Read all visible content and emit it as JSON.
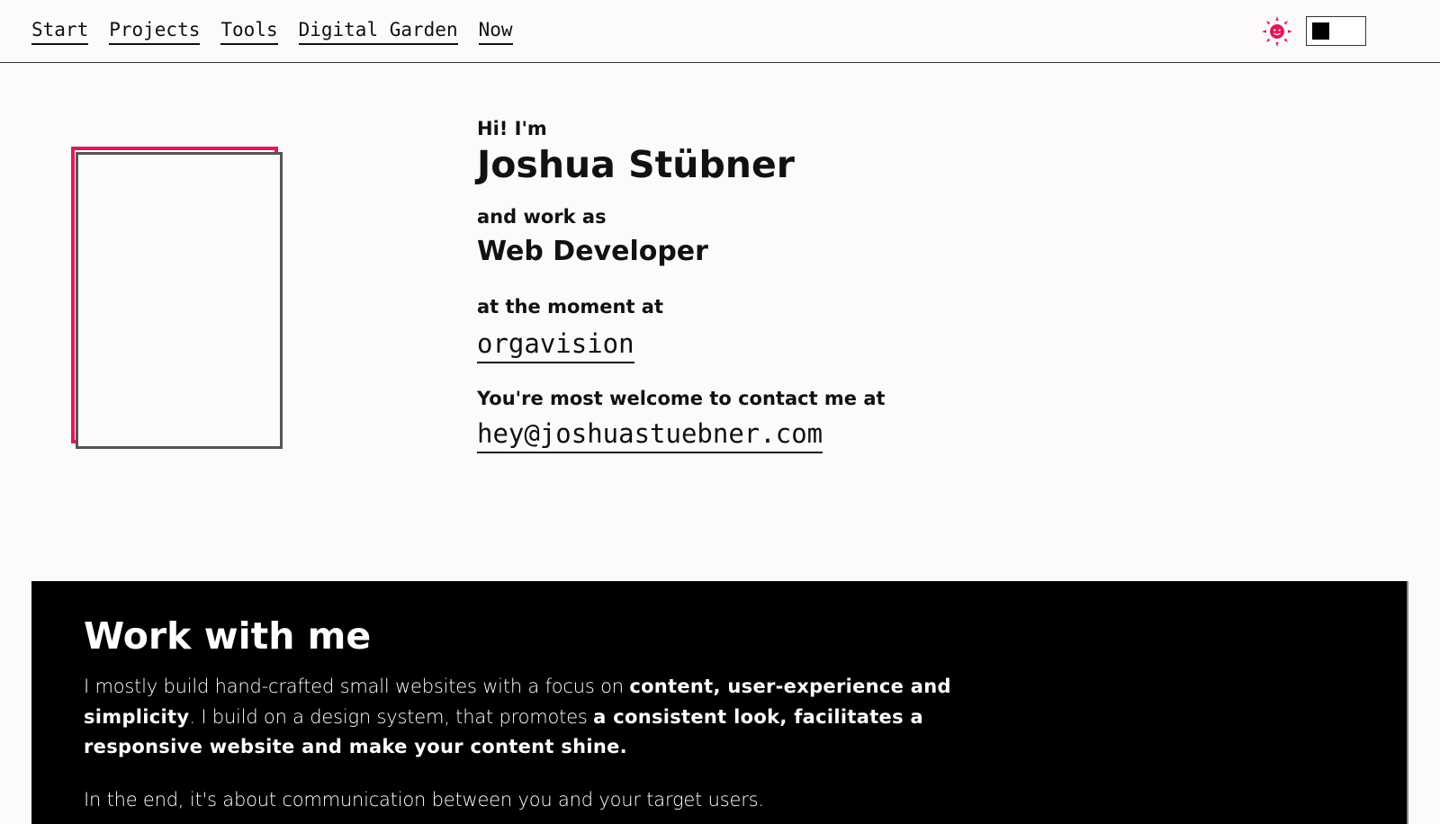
{
  "nav": {
    "items": [
      {
        "label": "Start"
      },
      {
        "label": "Projects"
      },
      {
        "label": "Tools"
      },
      {
        "label": "Digital Garden"
      },
      {
        "label": "Now"
      }
    ]
  },
  "theme": {
    "accent_color": "#e0195a",
    "light_icon": "sun-icon",
    "dark_icon": "moon-icon",
    "toggle_state": "light"
  },
  "hero": {
    "greeting": "Hi! I'm",
    "name": "Joshua Stübner",
    "work_intro": "and work as",
    "role": "Web Developer",
    "company_intro": "at the moment at",
    "company": "orgavision",
    "contact_intro": "You're most welcome to contact me at",
    "email": "hey@joshuastuebner.com"
  },
  "work": {
    "heading": "Work with me",
    "p1_a": "I mostly build hand-crafted small websites with a focus on ",
    "p1_b": "content, user-experience and simplicity",
    "p1_c": ". I build on a design system, that promotes ",
    "p1_d": "a consistent look, facilitates a responsive website and make your content shine.",
    "p2": "In the end, it's about communication between you and your target users."
  }
}
